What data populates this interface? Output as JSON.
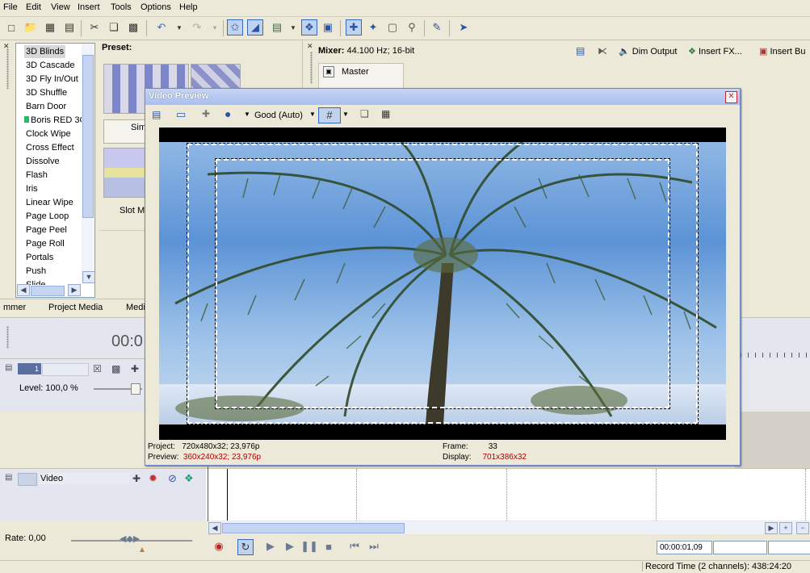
{
  "menu": [
    "File",
    "Edit",
    "View",
    "Insert",
    "Tools",
    "Options",
    "Help"
  ],
  "toolbar_icons": [
    "new-file",
    "open-folder",
    "save",
    "properties",
    "cut",
    "copy",
    "paste",
    "undo",
    "redo",
    "normal-edit-tool",
    "envelope-tool",
    "selection-tool",
    "auto-ripple",
    "lock-envelopes",
    "snapping",
    "enable-snapping",
    "quantize",
    "marker-snap",
    "event-fx",
    "what-is-this"
  ],
  "transitions": {
    "items": [
      "3D Blinds",
      "3D Cascade",
      "3D Fly In/Out",
      "3D Shuffle",
      "Barn Door",
      "Boris RED 3GL",
      "Clock Wipe",
      "Cross Effect",
      "Dissolve",
      "Flash",
      "Iris",
      "Linear Wipe",
      "Page Loop",
      "Page Peel",
      "Page Roll",
      "Portals",
      "Push",
      "Slide"
    ],
    "selected": "3D Blinds",
    "preset_label": "Preset:",
    "preset_names": [
      "Sim",
      "Slot Ma"
    ]
  },
  "tabs": [
    "mmer",
    "Project Media",
    "Medi"
  ],
  "mixer": {
    "label": "Mixer:",
    "info": "44.100 Hz; 16-bit",
    "dim_output": "Dim Output",
    "insert_fx": "Insert FX...",
    "insert_bus": "Insert Bu",
    "master": "Master"
  },
  "video_preview": {
    "title": "Video Preview",
    "quality": "Good (Auto)",
    "project_label": "Project:",
    "project_value": "720x480x32; 23,976p",
    "preview_label": "Preview:",
    "preview_value": "360x240x32; 23,976p",
    "frame_label": "Frame:",
    "frame_value": "33",
    "display_label": "Display:",
    "display_value": "701x386x32"
  },
  "timeline": {
    "time_partial": "00:0",
    "audio_track_level": "Level: 100,0 %",
    "track_number": "1",
    "video_track_name": "Video",
    "rate": "Rate: 0,00",
    "timecode": "00:00:01,09",
    "record_time": "Record Time (2 channels): 438:24:20"
  }
}
